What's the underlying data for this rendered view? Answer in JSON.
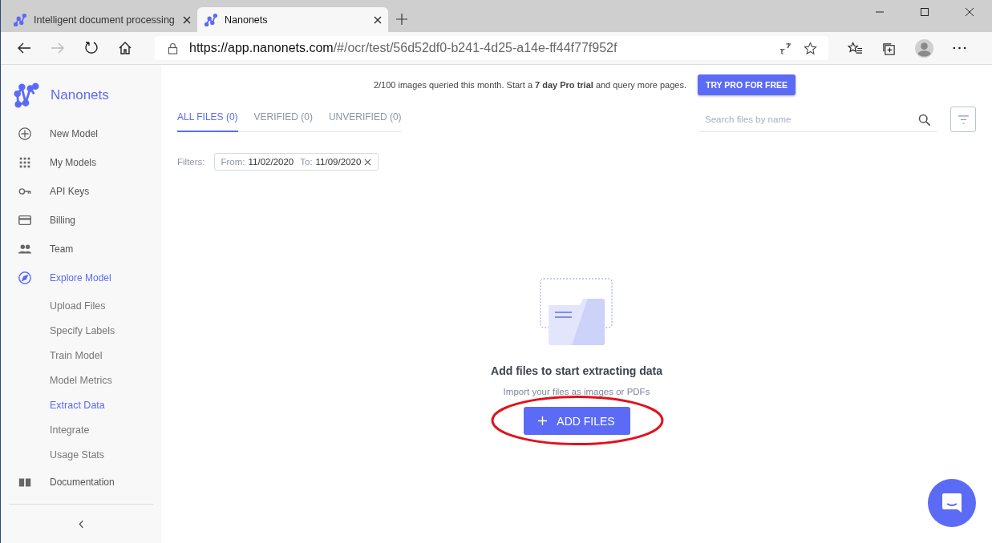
{
  "browser": {
    "tabs": [
      {
        "title": "Intelligent document processing",
        "selected": false
      },
      {
        "title": "Nanonets",
        "selected": true
      }
    ],
    "url_host": "https://app.nanonets.com",
    "url_path": "/#/ocr/test/56d52df0-b241-4d25-a14e-ff44f77f952f"
  },
  "sidebar": {
    "brand": "Nanonets",
    "items": [
      {
        "label": "New Model",
        "selected": false
      },
      {
        "label": "My Models",
        "selected": false
      },
      {
        "label": "API Keys",
        "selected": false
      },
      {
        "label": "Billing",
        "selected": false
      },
      {
        "label": "Team",
        "selected": false
      },
      {
        "label": "Explore Model",
        "selected": true,
        "children": [
          {
            "label": "Upload Files",
            "selected": false
          },
          {
            "label": "Specify Labels",
            "selected": false
          },
          {
            "label": "Train Model",
            "selected": false
          },
          {
            "label": "Model Metrics",
            "selected": false
          },
          {
            "label": "Extract Data",
            "selected": true
          },
          {
            "label": "Integrate",
            "selected": false
          },
          {
            "label": "Usage Stats",
            "selected": false
          }
        ]
      },
      {
        "label": "Documentation",
        "selected": false
      }
    ]
  },
  "banner": {
    "text": "2/100 images queried this month. Start a **7 day Pro trial** and query more pages.",
    "button": "TRY PRO FOR FREE"
  },
  "file_tabs": [
    {
      "label": "ALL FILES (0)",
      "selected": true
    },
    {
      "label": "VERIFIED (0)",
      "selected": false
    },
    {
      "label": "UNVERIFIED (0)",
      "selected": false
    }
  ],
  "search": {
    "placeholder": "Search files by name"
  },
  "filters": {
    "label": "Filters:",
    "from_label": "From:",
    "from": "11/02/2020",
    "to_label": "To:",
    "to": "11/09/2020"
  },
  "empty_state": {
    "title": "Add files to start extracting data",
    "subtitle": "Import your files as images or PDFs",
    "button": "ADD FILES",
    "circled": true
  }
}
